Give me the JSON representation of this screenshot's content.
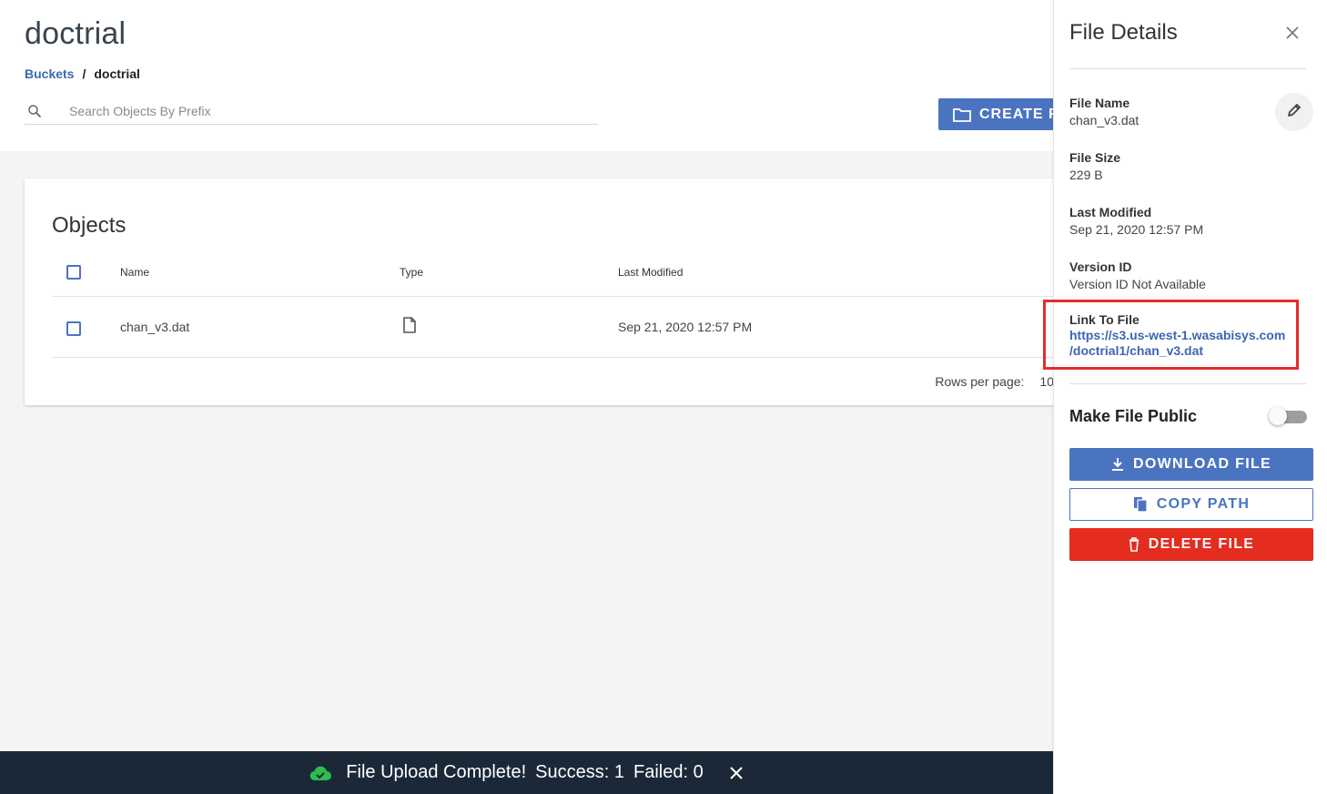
{
  "header": {
    "bucket_title": "doctrial",
    "breadcrumb": {
      "link": "Buckets",
      "separator": "/",
      "current": "doctrial"
    },
    "search_placeholder": "Search Objects By Prefix",
    "create_button_label": "CREATE FOLDER"
  },
  "objects": {
    "title": "Objects",
    "columns": [
      "Name",
      "Type",
      "Last Modified"
    ],
    "rows": [
      {
        "name": "chan_v3.dat",
        "type_icon": "file-icon",
        "last_modified": "Sep 21, 2020 12:57 PM"
      }
    ],
    "pagination": {
      "rows_per_page_label": "Rows per page:",
      "rows_per_page_value": "10"
    }
  },
  "snackbar": {
    "icon": "cloud-check-icon",
    "icon_color": "#2ebd4e",
    "message": "File Upload Complete!",
    "success": "Success: 1",
    "failed": "Failed: 0"
  },
  "details": {
    "title": "File Details",
    "file_name_label": "File Name",
    "file_name": "chan_v3.dat",
    "file_size_label": "File Size",
    "file_size": "229 B",
    "last_modified_label": "Last Modified",
    "last_modified": "Sep 21, 2020 12:57 PM",
    "version_id_label": "Version ID",
    "version_id": "Version ID Not Available",
    "link_label": "Link To File",
    "link_line1": "https://s3.us-west-1.wasabisys.com",
    "link_line2": "/doctrial1/chan_v3.dat",
    "make_public_label": "Make File Public",
    "make_public_enabled": false,
    "download_label": "DOWNLOAD FILE",
    "copy_label": "COPY PATH",
    "delete_label": "DELETE FILE"
  },
  "colors": {
    "primary": "#4a74c0",
    "danger": "#e42c1f",
    "highlight_box": "#e42c2c",
    "snackbar_bg": "#1b2838"
  }
}
